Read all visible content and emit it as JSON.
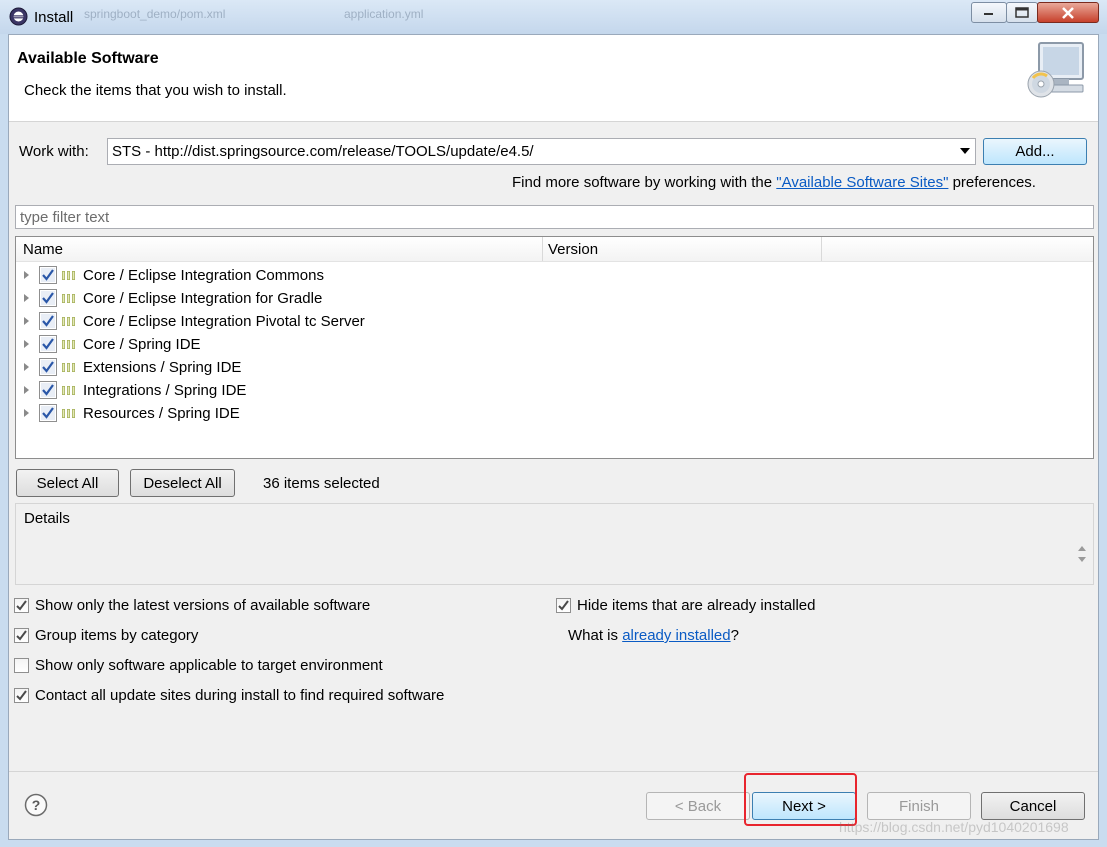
{
  "window": {
    "title": "Install",
    "background_tabs": [
      "springboot_demo/pom.xml",
      "application.yml"
    ]
  },
  "header": {
    "title": "Available Software",
    "description": "Check the items that you wish to install."
  },
  "work_with": {
    "label": "Work with:",
    "value": "STS - http://dist.springsource.com/release/TOOLS/update/e4.5/",
    "add_button": "Add...",
    "find_more_prefix": "Find more software by working with the ",
    "find_more_link": "\"Available Software Sites\"",
    "find_more_suffix": " preferences."
  },
  "filter": {
    "placeholder": "type filter text"
  },
  "tree": {
    "columns": [
      "Name",
      "Version"
    ],
    "items": [
      {
        "label": "Core / Eclipse Integration Commons",
        "checked": true
      },
      {
        "label": "Core / Eclipse Integration for Gradle",
        "checked": true
      },
      {
        "label": "Core / Eclipse Integration Pivotal tc Server",
        "checked": true
      },
      {
        "label": "Core / Spring IDE",
        "checked": true
      },
      {
        "label": "Extensions / Spring IDE",
        "checked": true
      },
      {
        "label": "Integrations / Spring IDE",
        "checked": true
      },
      {
        "label": "Resources / Spring IDE",
        "checked": true
      }
    ]
  },
  "selection": {
    "select_all": "Select All",
    "deselect_all": "Deselect All",
    "status": "36 items selected"
  },
  "details": {
    "label": "Details"
  },
  "options_left": [
    {
      "label": "Show only the latest versions of available software",
      "checked": true
    },
    {
      "label": "Group items by category",
      "checked": true
    },
    {
      "label": "Show only software applicable to target environment",
      "checked": false
    },
    {
      "label": "Contact all update sites during install to find required software",
      "checked": true
    }
  ],
  "options_right": {
    "hide_installed": {
      "label": "Hide items that are already installed",
      "checked": true
    },
    "what_is_prefix": "What is ",
    "what_is_link": "already installed",
    "what_is_suffix": "?"
  },
  "footer": {
    "back": "< Back",
    "next": "Next >",
    "finish": "Finish",
    "cancel": "Cancel"
  },
  "watermark": "https://blog.csdn.net/pyd1040201698",
  "colors": {
    "link": "#0a5bc4",
    "highlight": "#e8252e",
    "check": "#2a57a8"
  }
}
